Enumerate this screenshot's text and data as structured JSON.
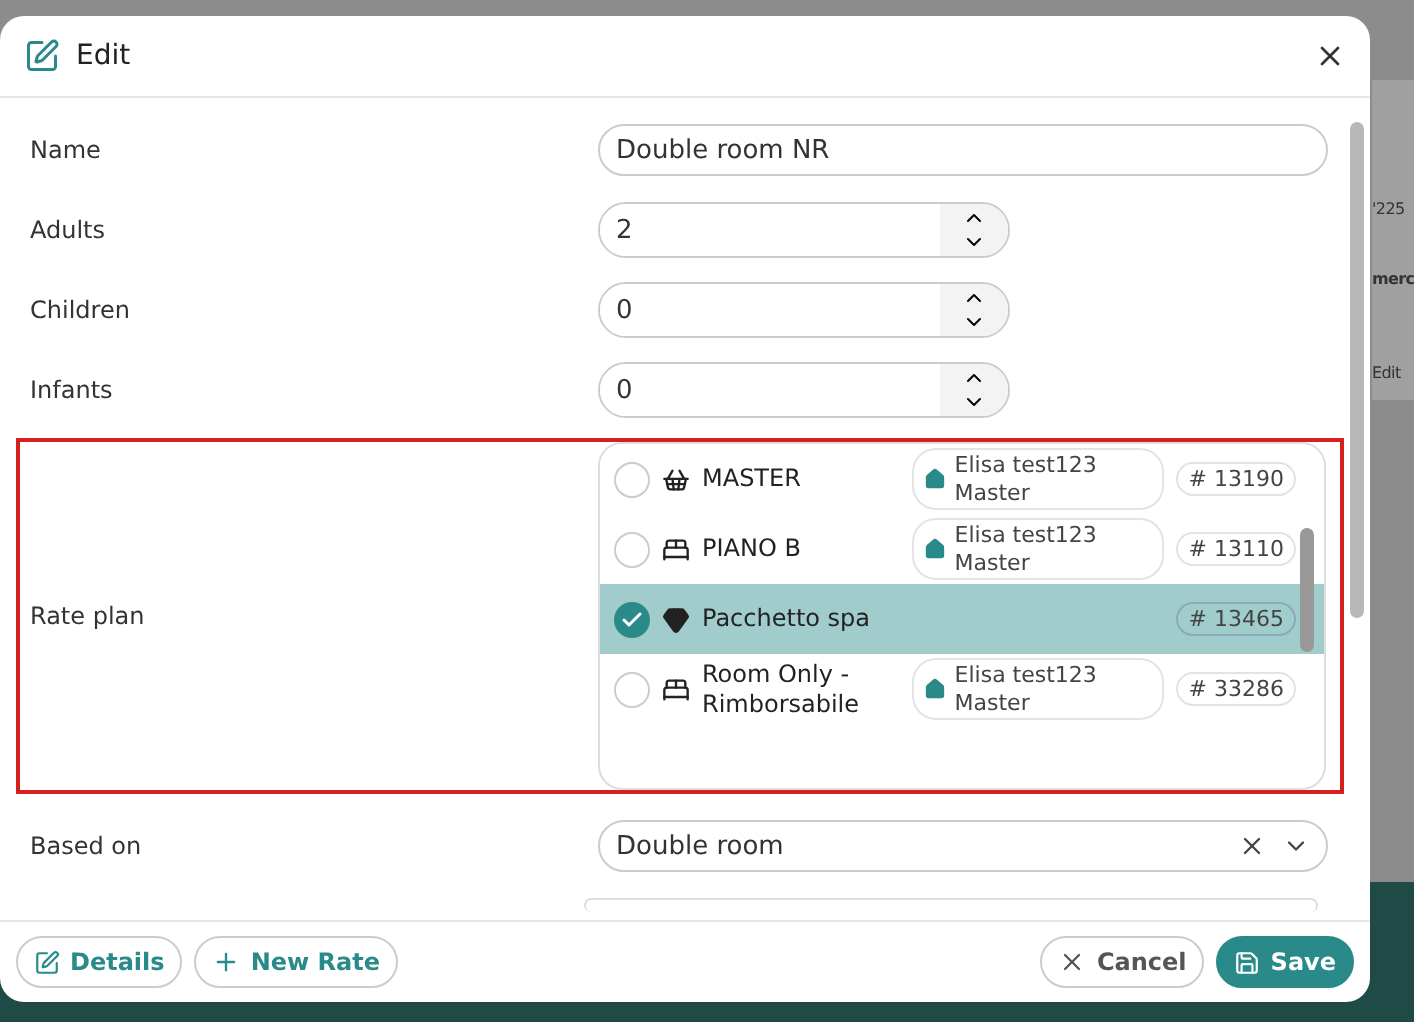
{
  "background": {
    "texts": [
      "'225",
      "merc",
      "Edit"
    ]
  },
  "dialog": {
    "title": "Edit"
  },
  "fields": [
    {
      "label": "Name",
      "kind": "text",
      "value": "Double room NR"
    },
    {
      "label": "Adults",
      "kind": "number",
      "value": "2"
    },
    {
      "label": "Children",
      "kind": "number",
      "value": "0"
    },
    {
      "label": "Infants",
      "kind": "number",
      "value": "0"
    }
  ],
  "rate_plan": {
    "label": "Rate plan",
    "highlighted": true,
    "options": [
      {
        "kind": "basket",
        "name": "MASTER",
        "property": "Elisa test123 Master",
        "code": "# 13190",
        "selected": false
      },
      {
        "kind": "bed",
        "name": "PIANO B",
        "property": "Elisa test123 Master",
        "code": "# 13110",
        "selected": false
      },
      {
        "kind": "gem",
        "name": "Pacchetto spa",
        "code": "# 13465",
        "selected": true
      },
      {
        "kind": "bed",
        "name": "Room Only - Rimborsabile",
        "property": "Elisa test123 Master",
        "code": "# 33286",
        "selected": false
      }
    ]
  },
  "based_on": {
    "label": "Based on",
    "value": "Double room"
  },
  "footer": {
    "left": [
      {
        "kind": "edit",
        "label": "Details"
      },
      {
        "kind": "add",
        "label": "New Rate"
      }
    ],
    "cancel": "Cancel",
    "save": "Save"
  }
}
